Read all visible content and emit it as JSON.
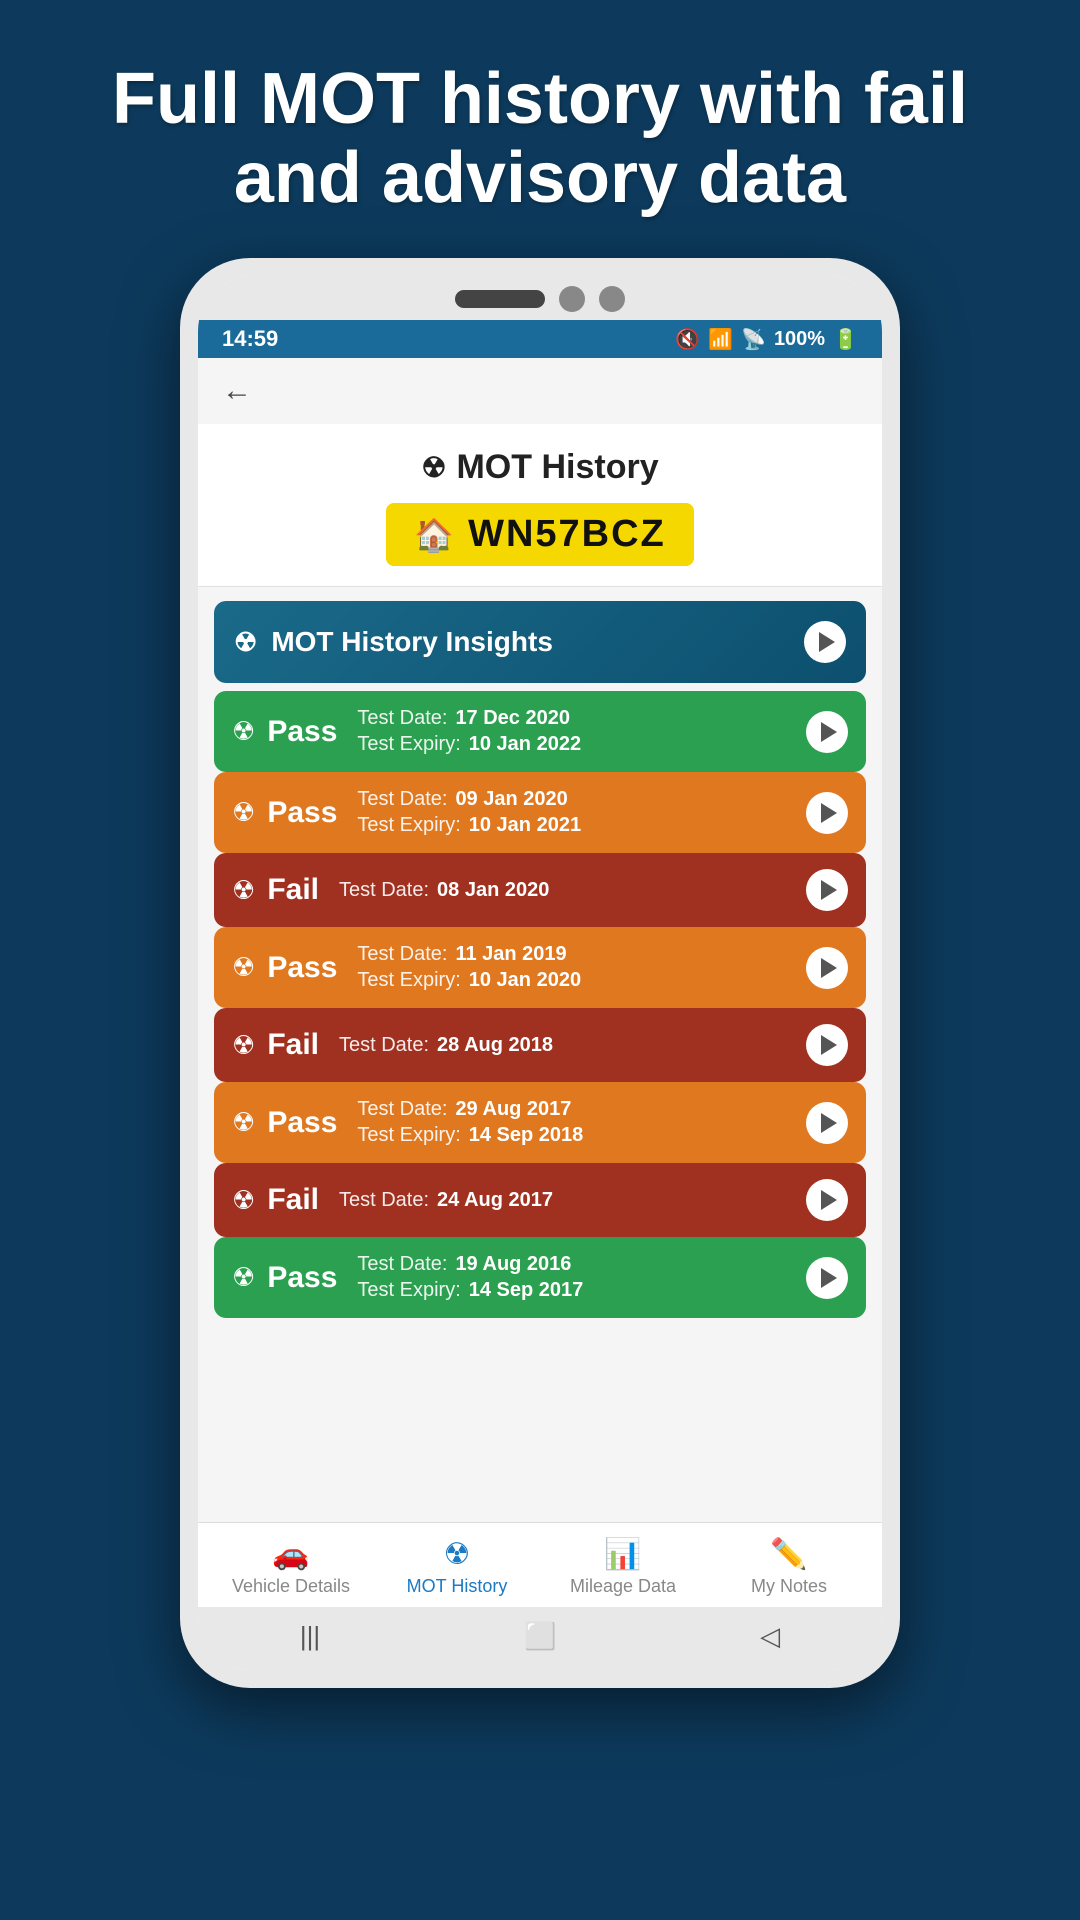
{
  "hero": {
    "title": "Full MOT history with fail and advisory data"
  },
  "statusBar": {
    "time": "14:59",
    "battery": "100%",
    "signal": "WiFi + 4G"
  },
  "pageHeader": {
    "title": "MOT History",
    "plate": "WN57BCZ"
  },
  "insights": {
    "label": "MOT History Insights"
  },
  "motResults": [
    {
      "id": 1,
      "result": "Pass",
      "colorClass": "mot-pass-green",
      "testDate": "17 Dec 2020",
      "testExpiry": "10 Jan 2022",
      "hasExpiry": true
    },
    {
      "id": 2,
      "result": "Pass",
      "colorClass": "mot-pass-orange",
      "testDate": "09 Jan 2020",
      "testExpiry": "10 Jan 2021",
      "hasExpiry": true
    },
    {
      "id": 3,
      "result": "Fail",
      "colorClass": "mot-fail",
      "testDate": "08 Jan 2020",
      "testExpiry": null,
      "hasExpiry": false
    },
    {
      "id": 4,
      "result": "Pass",
      "colorClass": "mot-pass-orange",
      "testDate": "11 Jan 2019",
      "testExpiry": "10 Jan 2020",
      "hasExpiry": true
    },
    {
      "id": 5,
      "result": "Fail",
      "colorClass": "mot-fail",
      "testDate": "28 Aug 2018",
      "testExpiry": null,
      "hasExpiry": false
    },
    {
      "id": 6,
      "result": "Pass",
      "colorClass": "mot-pass-orange",
      "testDate": "29 Aug 2017",
      "testExpiry": "14 Sep 2018",
      "hasExpiry": true
    },
    {
      "id": 7,
      "result": "Fail",
      "colorClass": "mot-fail",
      "testDate": "24 Aug 2017",
      "testExpiry": null,
      "hasExpiry": false
    },
    {
      "id": 8,
      "result": "Pass",
      "colorClass": "mot-pass-green",
      "testDate": "19 Aug 2016",
      "testExpiry": "14 Sep 2017",
      "hasExpiry": true
    }
  ],
  "bottomNav": {
    "items": [
      {
        "id": "vehicle-details",
        "label": "Vehicle Details",
        "icon": "car",
        "active": false
      },
      {
        "id": "mot-history",
        "label": "MOT History",
        "icon": "radiation",
        "active": true
      },
      {
        "id": "mileage-data",
        "label": "Mileage Data",
        "icon": "chart",
        "active": false
      },
      {
        "id": "my-notes",
        "label": "My Notes",
        "icon": "pencil",
        "active": false
      }
    ]
  },
  "labels": {
    "testDate": "Test Date:",
    "testExpiry": "Test Expiry:"
  }
}
